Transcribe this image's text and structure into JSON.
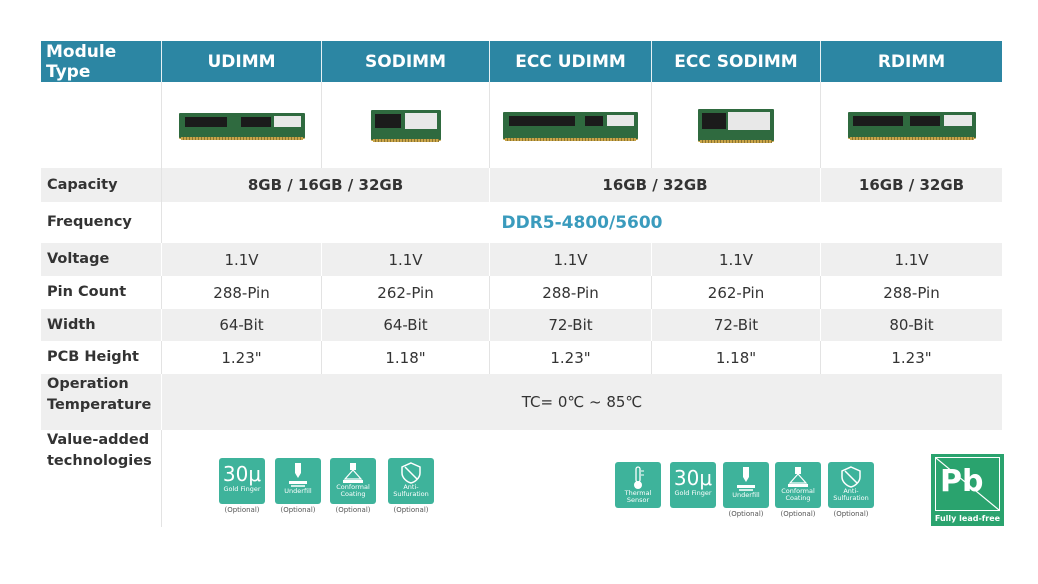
{
  "header": {
    "module_type": "Module Type",
    "columns": [
      "UDIMM",
      "SODIMM",
      "ECC UDIMM",
      "ECC SODIMM",
      "RDIMM"
    ]
  },
  "rows": {
    "capacity": {
      "label": "Capacity",
      "udimm_sodimm": "8GB / 16GB / 32GB",
      "ecc": "16GB / 32GB",
      "rdimm": "16GB / 32GB"
    },
    "frequency": {
      "label": "Frequency",
      "value": "DDR5-4800/5600"
    },
    "voltage": {
      "label": "Voltage",
      "values": [
        "1.1V",
        "1.1V",
        "1.1V",
        "1.1V",
        "1.1V"
      ]
    },
    "pin_count": {
      "label": "Pin Count",
      "values": [
        "288-Pin",
        "262-Pin",
        "288-Pin",
        "262-Pin",
        "288-Pin"
      ]
    },
    "width": {
      "label": "Width",
      "values": [
        "64-Bit",
        "64-Bit",
        "72-Bit",
        "72-Bit",
        "80-Bit"
      ]
    },
    "pcb_height": {
      "label": "PCB Height",
      "values": [
        "1.23\"",
        "1.18\"",
        "1.23\"",
        "1.18\"",
        "1.23\""
      ]
    },
    "operation_temperature": {
      "label_line1": "Operation",
      "label_line2": "Temperature",
      "value": "TC= 0℃ ~ 85℃"
    },
    "value_added": {
      "label_line1": "Value-added",
      "label_line2": "technologies"
    }
  },
  "tech_left": [
    {
      "icon": "gold-finger-icon",
      "big": "30μ",
      "caption": "Gold Finger",
      "optional": "(Optional)"
    },
    {
      "icon": "underfill-icon",
      "caption": "Underfill",
      "optional": "(Optional)"
    },
    {
      "icon": "conformal-coating-icon",
      "caption": "Conformal Coating",
      "optional": "(Optional)"
    },
    {
      "icon": "anti-sulfuration-icon",
      "caption": "Anti-Sulfuration",
      "optional": "(Optional)"
    }
  ],
  "tech_right": [
    {
      "icon": "thermal-sensor-icon",
      "caption": "Thermal Sensor"
    },
    {
      "icon": "gold-finger-icon",
      "big": "30μ",
      "caption": "Gold Finger"
    },
    {
      "icon": "underfill-icon",
      "caption": "Underfill",
      "optional": "(Optional)"
    },
    {
      "icon": "conformal-coating-icon",
      "caption": "Conformal Coating",
      "optional": "(Optional)"
    },
    {
      "icon": "anti-sulfuration-icon",
      "caption": "Anti-Sulfuration",
      "optional": "(Optional)"
    }
  ],
  "lead_free": {
    "symbol": "Pb",
    "label": "Fully lead-free"
  },
  "colors": {
    "header": "#2c86a3",
    "frequency": "#3a9bbd",
    "icon_green": "#3eb39b",
    "lead_free_green": "#2aa36e"
  }
}
